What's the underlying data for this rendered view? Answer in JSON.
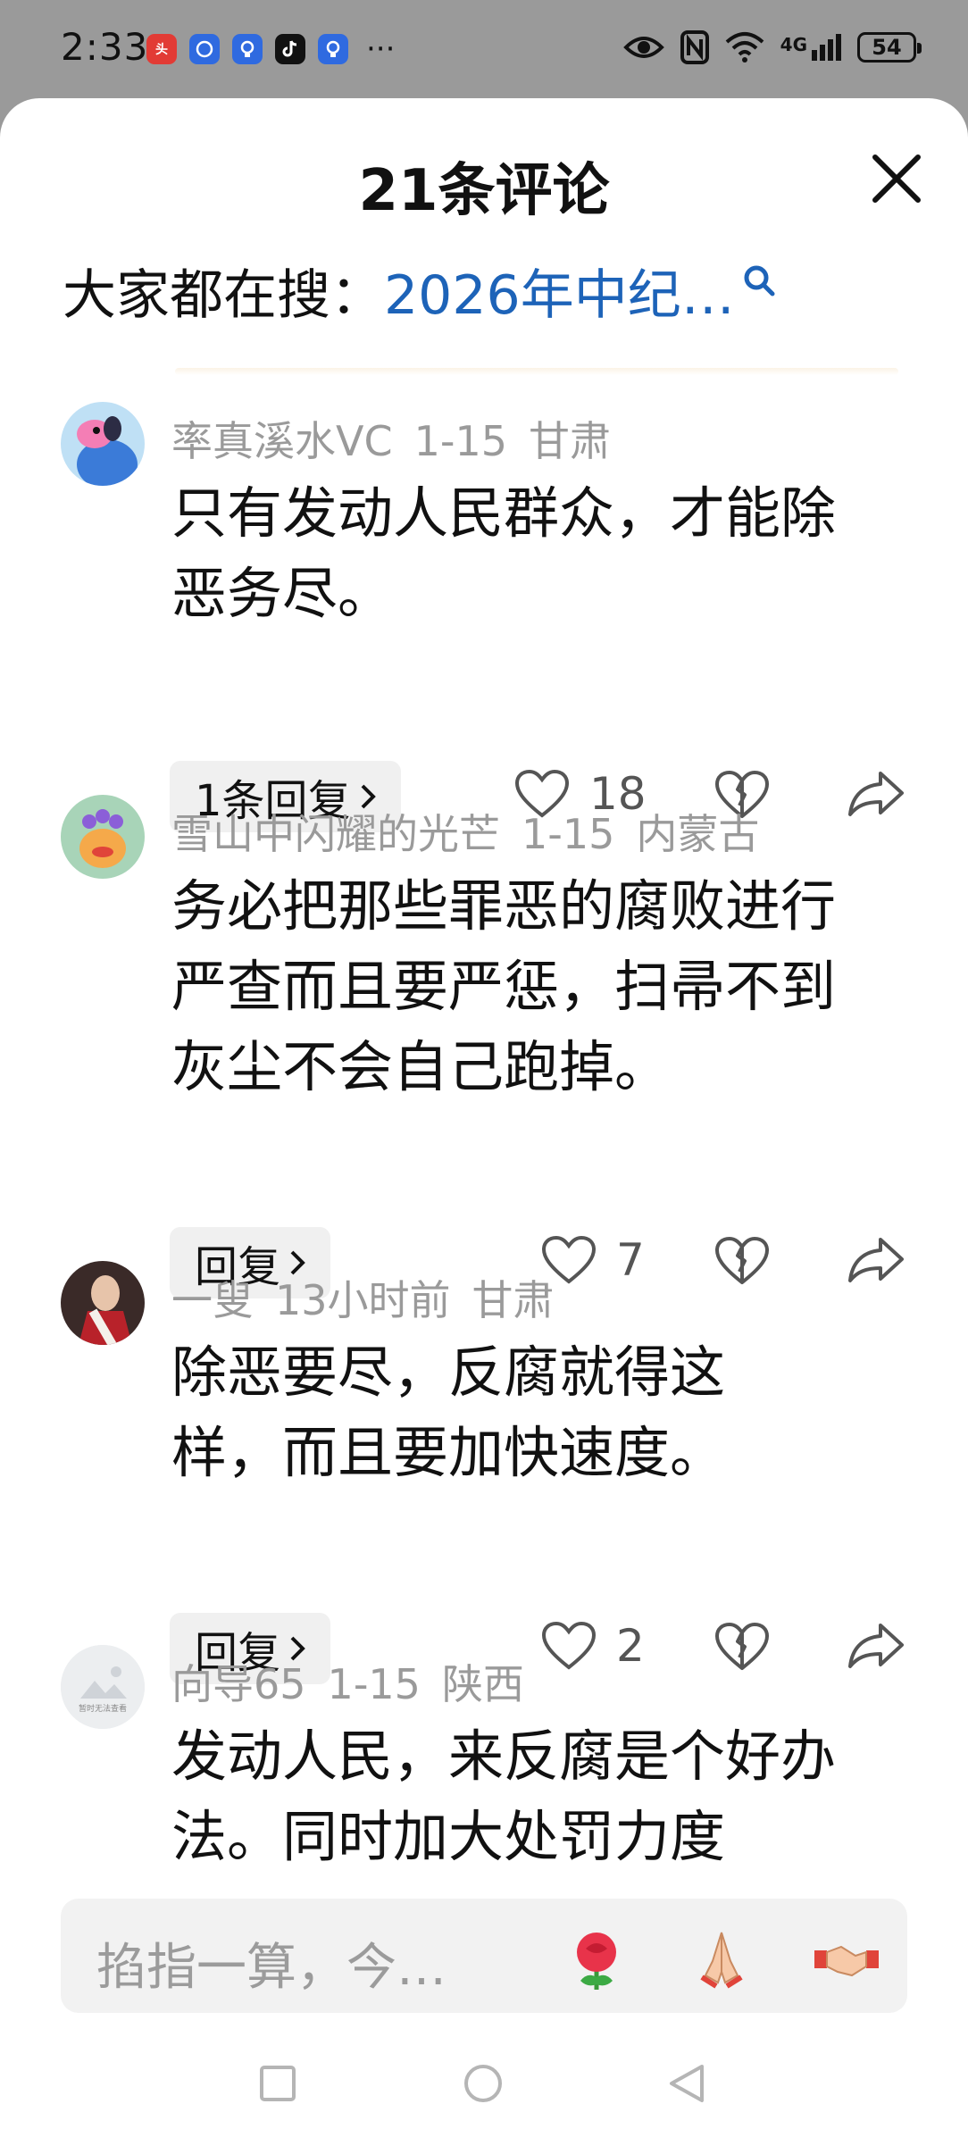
{
  "status_bar": {
    "time": "2:33",
    "app_icons": [
      "toutiao-icon",
      "baidu-icon",
      "bulb-icon",
      "tiktok-icon",
      "bulb-icon"
    ],
    "overflow": "···",
    "network": "4G",
    "battery": "54"
  },
  "sheet": {
    "title": "21条评论",
    "search_prefix": "大家都在搜：",
    "search_query": "2026年中纪…"
  },
  "comments": [
    {
      "username": "率真溪水VC",
      "date": "1-15",
      "location": "甘肃",
      "text": "只有发动人民群众，才能除恶务尽。",
      "reply_label": "1条回复",
      "likes": "18"
    },
    {
      "username": "雪山中闪耀的光芒",
      "date": "1-15",
      "location": "内蒙古",
      "text": "务必把那些罪恶的腐败进行严查而且要严惩，扫帚不到灰尘不会自己跑掉。",
      "reply_label": "回复",
      "likes": "7"
    },
    {
      "username": "一叟",
      "date": "13小时前",
      "location": "甘肃",
      "text": "除恶要尽，反腐就得这样，而且要加快速度。",
      "reply_label": "回复",
      "likes": "2"
    },
    {
      "username": "向导65",
      "date": "1-15",
      "location": "陕西",
      "text": "发动人民，来反腐是个好办法。同时加大处罚力度",
      "avatar_caption": "暂时无法查看"
    }
  ],
  "input": {
    "placeholder": "掐指一算，今…",
    "emoji_buttons": [
      "rose-emoji",
      "pray-emoji",
      "handshake-emoji"
    ]
  },
  "colors": {
    "link": "#1d63b8",
    "meta": "#9a9a9a",
    "status_bg": "#9a9a9a"
  }
}
